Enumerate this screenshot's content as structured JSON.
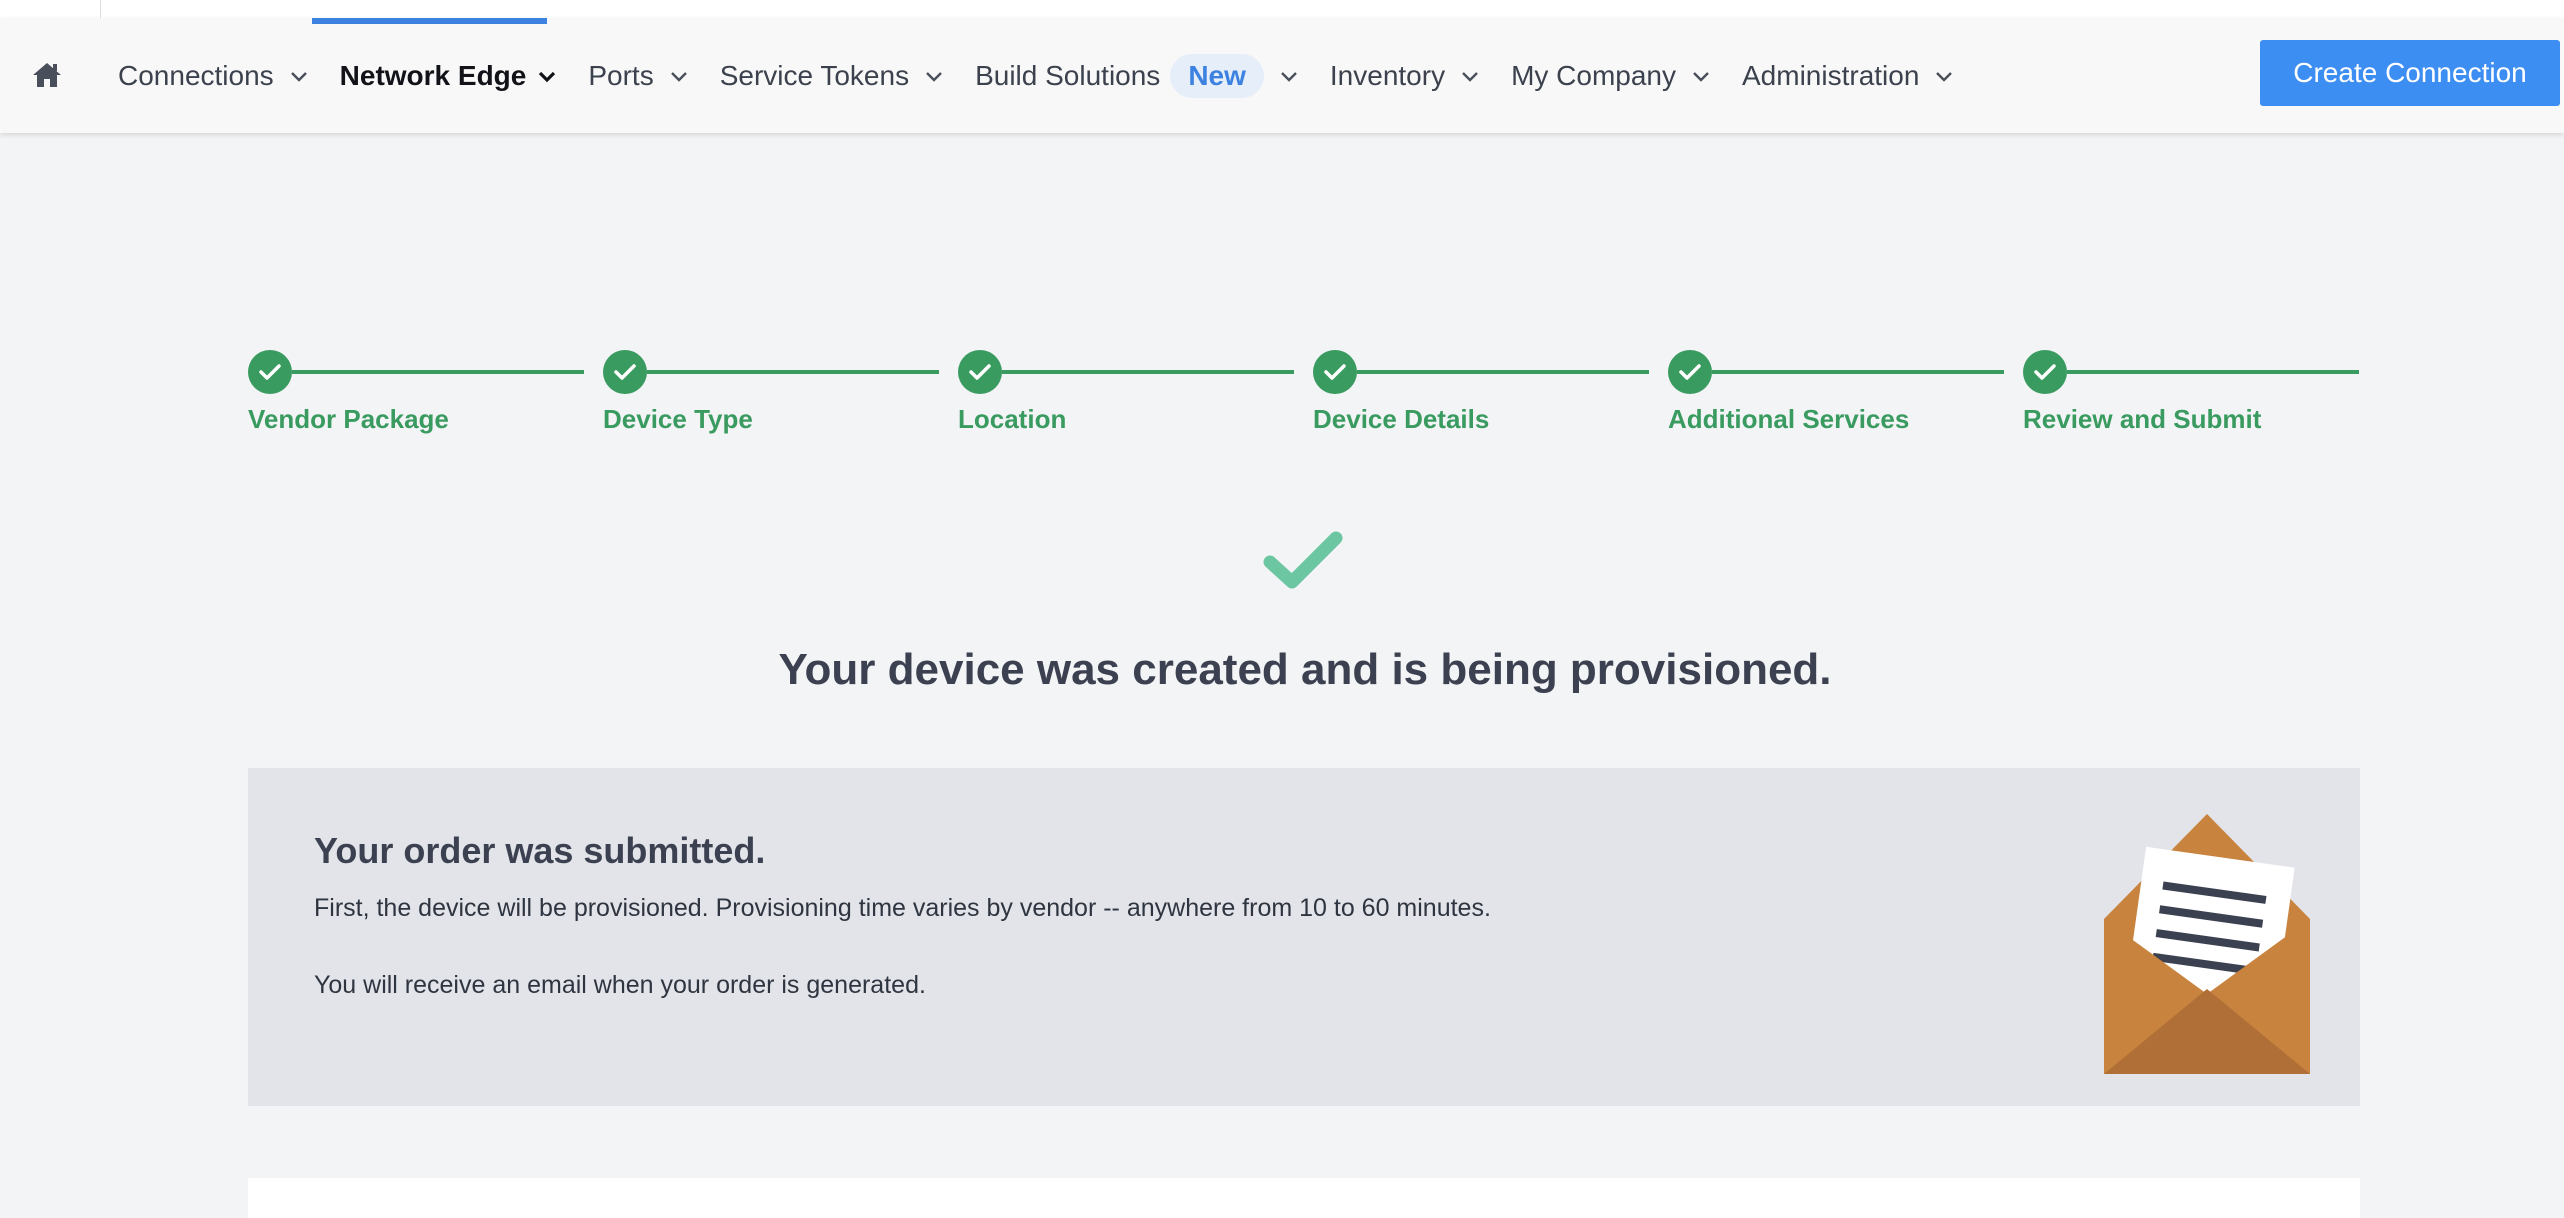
{
  "nav": {
    "home_icon": "home-icon",
    "items": [
      {
        "label": "Connections",
        "active": false
      },
      {
        "label": "Network Edge",
        "active": true
      },
      {
        "label": "Ports",
        "active": false
      },
      {
        "label": "Service Tokens",
        "active": false
      },
      {
        "label": "Build Solutions",
        "badge": "New",
        "active": false
      },
      {
        "label": "Inventory",
        "active": false
      },
      {
        "label": "My Company",
        "active": false
      },
      {
        "label": "Administration",
        "active": false
      }
    ],
    "create_button": "Create Connection"
  },
  "stepper": {
    "steps": [
      {
        "label": "Vendor Package",
        "status": "complete"
      },
      {
        "label": "Device Type",
        "status": "complete"
      },
      {
        "label": "Location",
        "status": "complete"
      },
      {
        "label": "Device Details",
        "status": "complete"
      },
      {
        "label": "Additional Services",
        "status": "complete"
      },
      {
        "label": "Review and Submit",
        "status": "complete"
      }
    ]
  },
  "success": {
    "title": "Your device was created and is being provisioned."
  },
  "order": {
    "title": "Your order was submitted.",
    "line1": "First, the device will be provisioned. Provisioning time varies by vendor -- anywhere from 10 to 60 minutes.",
    "line2": "You will receive an email when your order is generated.",
    "icon": "envelope-letter-icon"
  },
  "colors": {
    "accent": "#3d82e0",
    "button": "#3d8ef2",
    "success": "#3a9b60",
    "success_check": "#6cc6a2",
    "envelope": "#c8833e",
    "envelope_dark": "#b06f36"
  }
}
